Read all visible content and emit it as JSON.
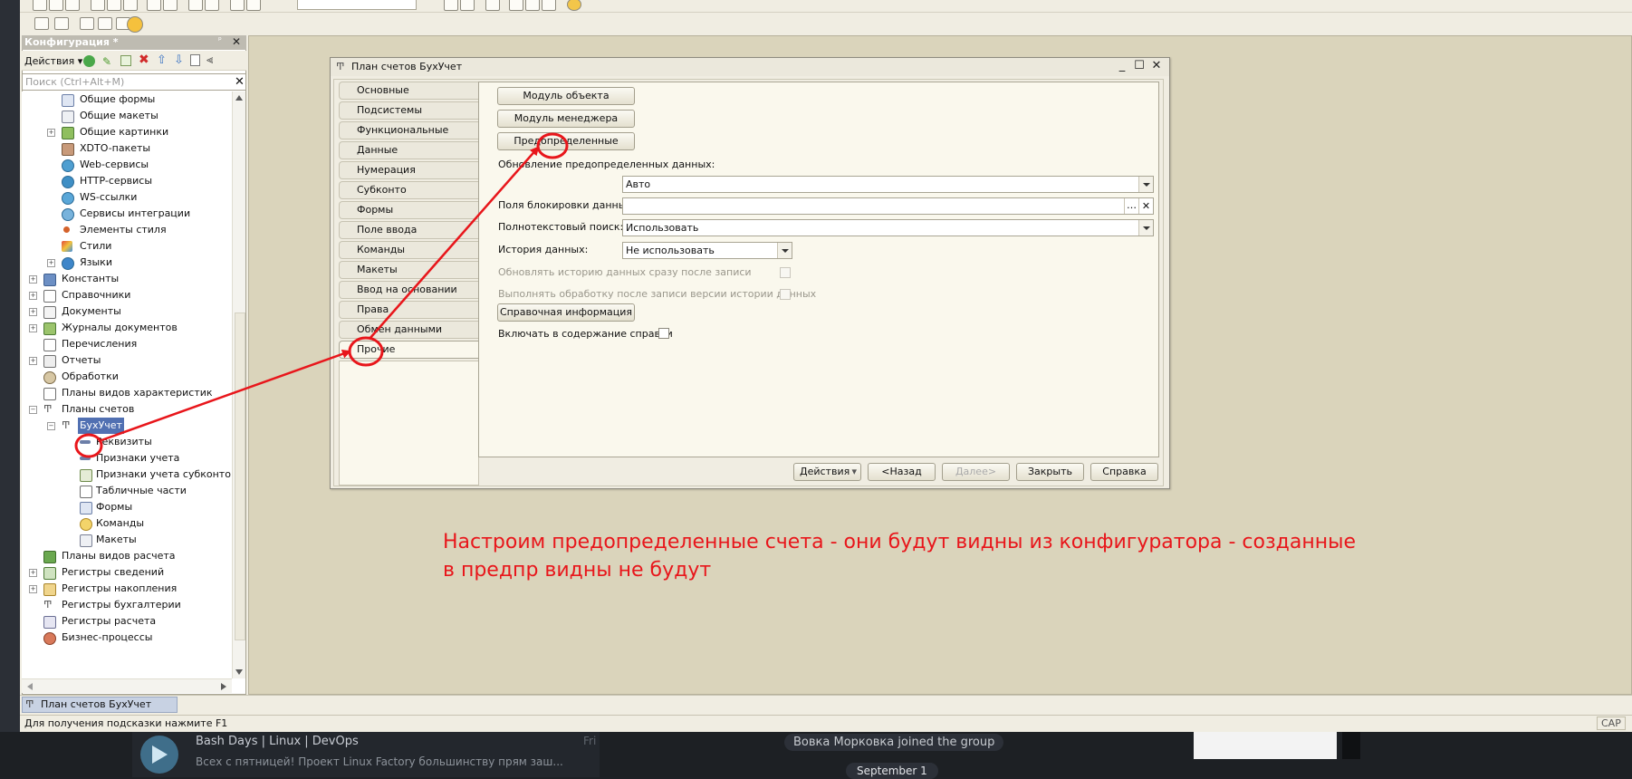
{
  "telegram": {
    "chat_name": "Bash Days | Linux | DevOps",
    "chat_preview": "Всех с пятницей!  Проект Linux Factory большинству прям заш...",
    "chat_day": "Fri",
    "join_notice": "Вовка Морковка joined the group",
    "date_badge": "September 1"
  },
  "config_panel": {
    "title": "Конфигурация *",
    "actions_label": "Действия",
    "search_placeholder": "Поиск (Ctrl+Alt+M)",
    "tree": [
      {
        "label": "Общие формы"
      },
      {
        "label": "Общие макеты"
      },
      {
        "label": "Общие картинки"
      },
      {
        "label": "XDTO-пакеты"
      },
      {
        "label": "Web-сервисы"
      },
      {
        "label": "HTTP-сервисы"
      },
      {
        "label": "WS-ссылки"
      },
      {
        "label": "Сервисы интеграции"
      },
      {
        "label": "Элементы стиля"
      },
      {
        "label": "Стили"
      },
      {
        "label": "Языки"
      },
      {
        "label": "Константы"
      },
      {
        "label": "Справочники"
      },
      {
        "label": "Документы"
      },
      {
        "label": "Журналы документов"
      },
      {
        "label": "Перечисления"
      },
      {
        "label": "Отчеты"
      },
      {
        "label": "Обработки"
      },
      {
        "label": "Планы видов характеристик"
      },
      {
        "label": "Планы счетов"
      },
      {
        "label": "БухУчет"
      },
      {
        "label": "Реквизиты"
      },
      {
        "label": "Признаки учета"
      },
      {
        "label": "Признаки учета субконто"
      },
      {
        "label": "Табличные части"
      },
      {
        "label": "Формы"
      },
      {
        "label": "Команды"
      },
      {
        "label": "Макеты"
      },
      {
        "label": "Планы видов расчета"
      },
      {
        "label": "Регистры сведений"
      },
      {
        "label": "Регистры накопления"
      },
      {
        "label": "Регистры бухгалтерии"
      },
      {
        "label": "Регистры расчета"
      },
      {
        "label": "Бизнес-процессы"
      }
    ]
  },
  "dialog": {
    "title": "План счетов БухУчет",
    "tabs": [
      "Основные",
      "Подсистемы",
      "Функциональные опции",
      "Данные",
      "Нумерация",
      "Субконто",
      "Формы",
      "Поле ввода",
      "Команды",
      "Макеты",
      "Ввод на основании",
      "Права",
      "Обмен данными",
      "Прочие"
    ],
    "buttons": {
      "object_module": "Модуль объекта",
      "manager_module": "Модуль менеджера",
      "predefined": "Предопределенные",
      "help_info": "Справочная информация"
    },
    "fields": {
      "update_predefined_label": "Обновление предопределенных данных:",
      "update_predefined_value": "Авто",
      "lock_fields_label": "Поля блокировки данных:",
      "lock_fields_value": "",
      "fulltext_label": "Полнотекстовый поиск:",
      "fulltext_value": "Использовать",
      "history_label": "История данных:",
      "history_value": "Не использовать",
      "update_history_label": "Обновлять историю данных сразу после записи",
      "process_after_label": "Выполнять обработку после записи версии истории данных",
      "include_help_label": "Включать в содержание справки"
    },
    "footer": {
      "actions": "Действия",
      "back": "<Назад",
      "next": "Далее>",
      "close": "Закрыть",
      "help": "Справка"
    }
  },
  "annotation": {
    "line1": "Настроим предопределенные счета - они будут видны из конфигуратора - созданные",
    "line2": "в предпр видны не будут",
    "color": "#e8161b"
  },
  "window_bar": {
    "tab_label": "План счетов БухУчет"
  },
  "status_bar": {
    "hint": "Для получения подсказки нажмите F1",
    "cap": "CAP"
  }
}
